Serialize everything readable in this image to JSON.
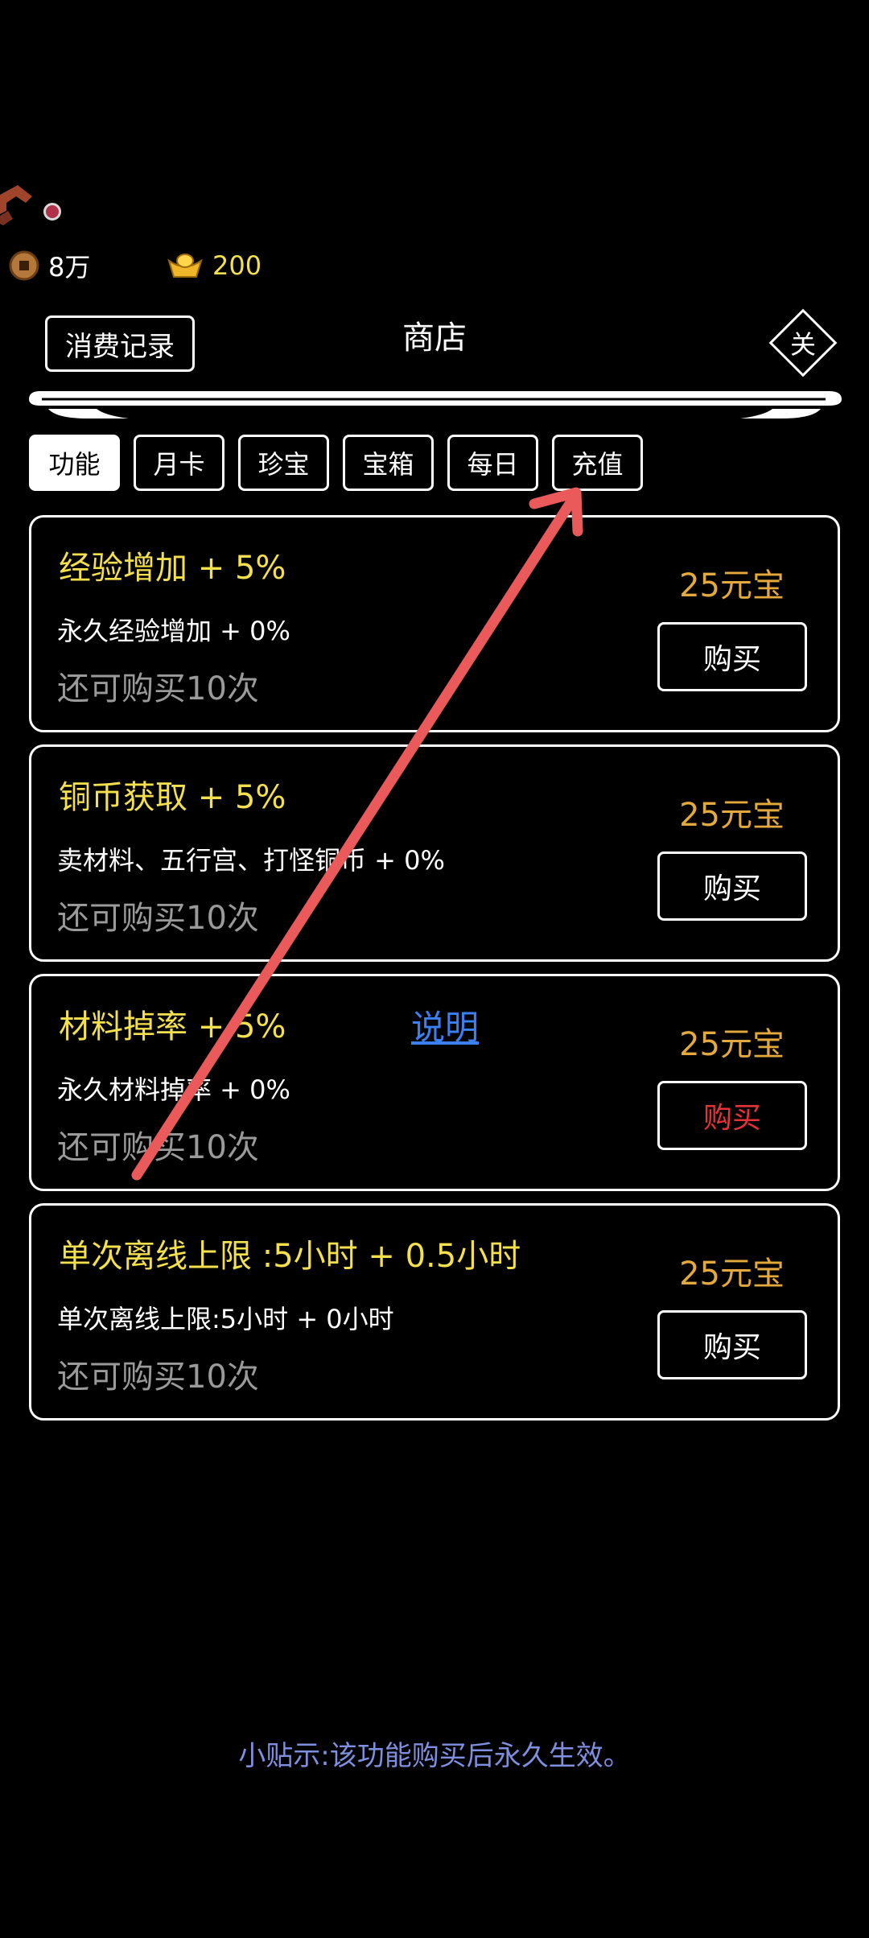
{
  "currency": {
    "copper": "8万",
    "ingot": "200"
  },
  "header": {
    "record_label": "消费记录",
    "title": "商店",
    "close_label": "关"
  },
  "tabs": [
    "功能",
    "月卡",
    "珍宝",
    "宝箱",
    "每日",
    "充值"
  ],
  "items": [
    {
      "title": "经验增加 + 5%",
      "desc": "永久经验增加 + 0%",
      "remaining": "还可购买10次",
      "price": "25元宝",
      "buy": "购买"
    },
    {
      "title": "铜币获取 + 5%",
      "desc": "卖材料、五行宫、打怪铜币 + 0%",
      "remaining": "还可购买10次",
      "price": "25元宝",
      "buy": "购买"
    },
    {
      "title": "材料掉率 + 5%",
      "desc": "永久材料掉率 + 0%",
      "remaining": "还可购买10次",
      "price": "25元宝",
      "buy": "购买",
      "explain": "说明"
    },
    {
      "title": "单次离线上限 :5小时 + 0.5小时",
      "desc": "单次离线上限:5小时 + 0小时",
      "remaining": "还可购买10次",
      "price": "25元宝",
      "buy": "购买"
    }
  ],
  "tip": "小贴示:该功能购买后永久生效。",
  "colors": {
    "title_yellow": "#f4e04d",
    "price_orange": "#e4a93c",
    "buy_red": "#e53237",
    "link_blue": "#3b7ff0",
    "tip_blue": "#7f8fe0",
    "arrow_red": "#ea5a5a"
  }
}
